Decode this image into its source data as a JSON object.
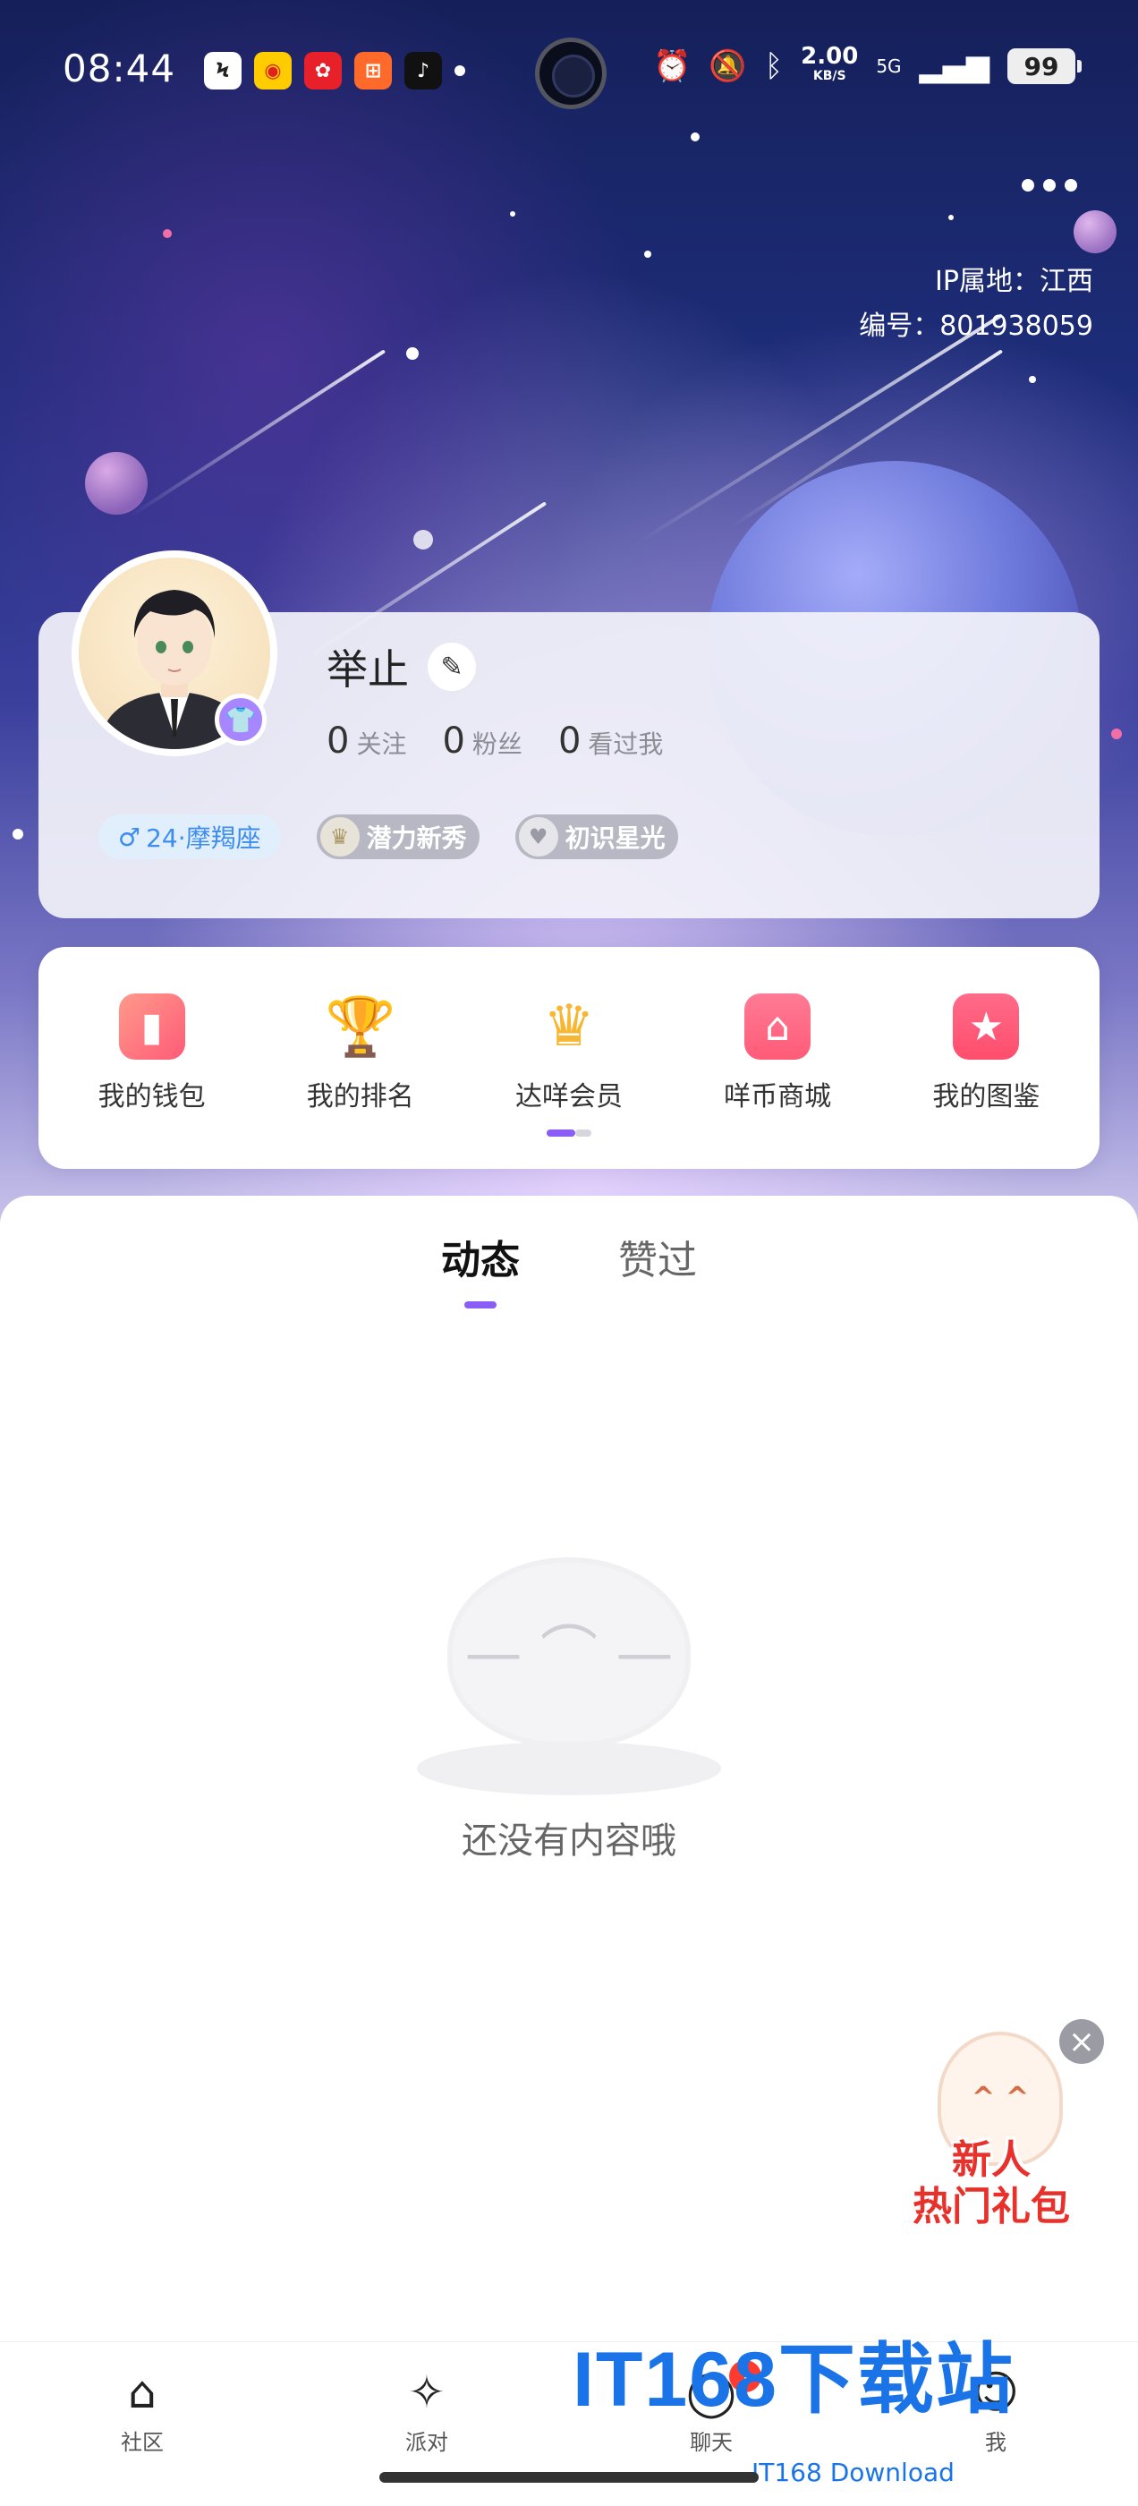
{
  "status_bar": {
    "time": "08:44",
    "network_speed": "2.00",
    "network_unit": "KB/S",
    "network_type": "5G",
    "battery": "99"
  },
  "header": {
    "ip_location": "IP属地：江西",
    "user_id": "编号：801938059"
  },
  "profile": {
    "name": "举止",
    "stats": [
      {
        "num": "0",
        "label": "关注"
      },
      {
        "num": "0",
        "label": "粉丝"
      },
      {
        "num": "0",
        "label": "看过我"
      }
    ],
    "age_tag": "24·摩羯座",
    "gender_symbol": "♂",
    "badges": [
      "潜力新秀",
      "初识星光"
    ]
  },
  "menu": {
    "items": [
      {
        "label": "我的钱包",
        "color": "#ff5b77"
      },
      {
        "label": "我的排名",
        "color": "#f5a623"
      },
      {
        "label": "达咩会员",
        "color": "#f7b733"
      },
      {
        "label": "咩币商城",
        "color": "#ff5b77"
      },
      {
        "label": "我的图鉴",
        "color": "#ff4d6d"
      }
    ]
  },
  "tabs": [
    {
      "label": "动态"
    },
    {
      "label": "赞过"
    }
  ],
  "empty_state": {
    "text": "还没有内容哦"
  },
  "promo": {
    "line1": "新人",
    "line2": "热门礼包"
  },
  "bottom_nav": {
    "items": [
      {
        "label": "社区"
      },
      {
        "label": "派对"
      },
      {
        "label": "聊天",
        "badge": "1"
      },
      {
        "label": "我"
      }
    ]
  },
  "watermark": {
    "logo": "IT168下载站",
    "sub": "IT168 Download"
  },
  "colors": {
    "accent": "#8b5cf6",
    "age_tag_text": "#3d8cf0",
    "badge_red": "#ff3b30"
  }
}
